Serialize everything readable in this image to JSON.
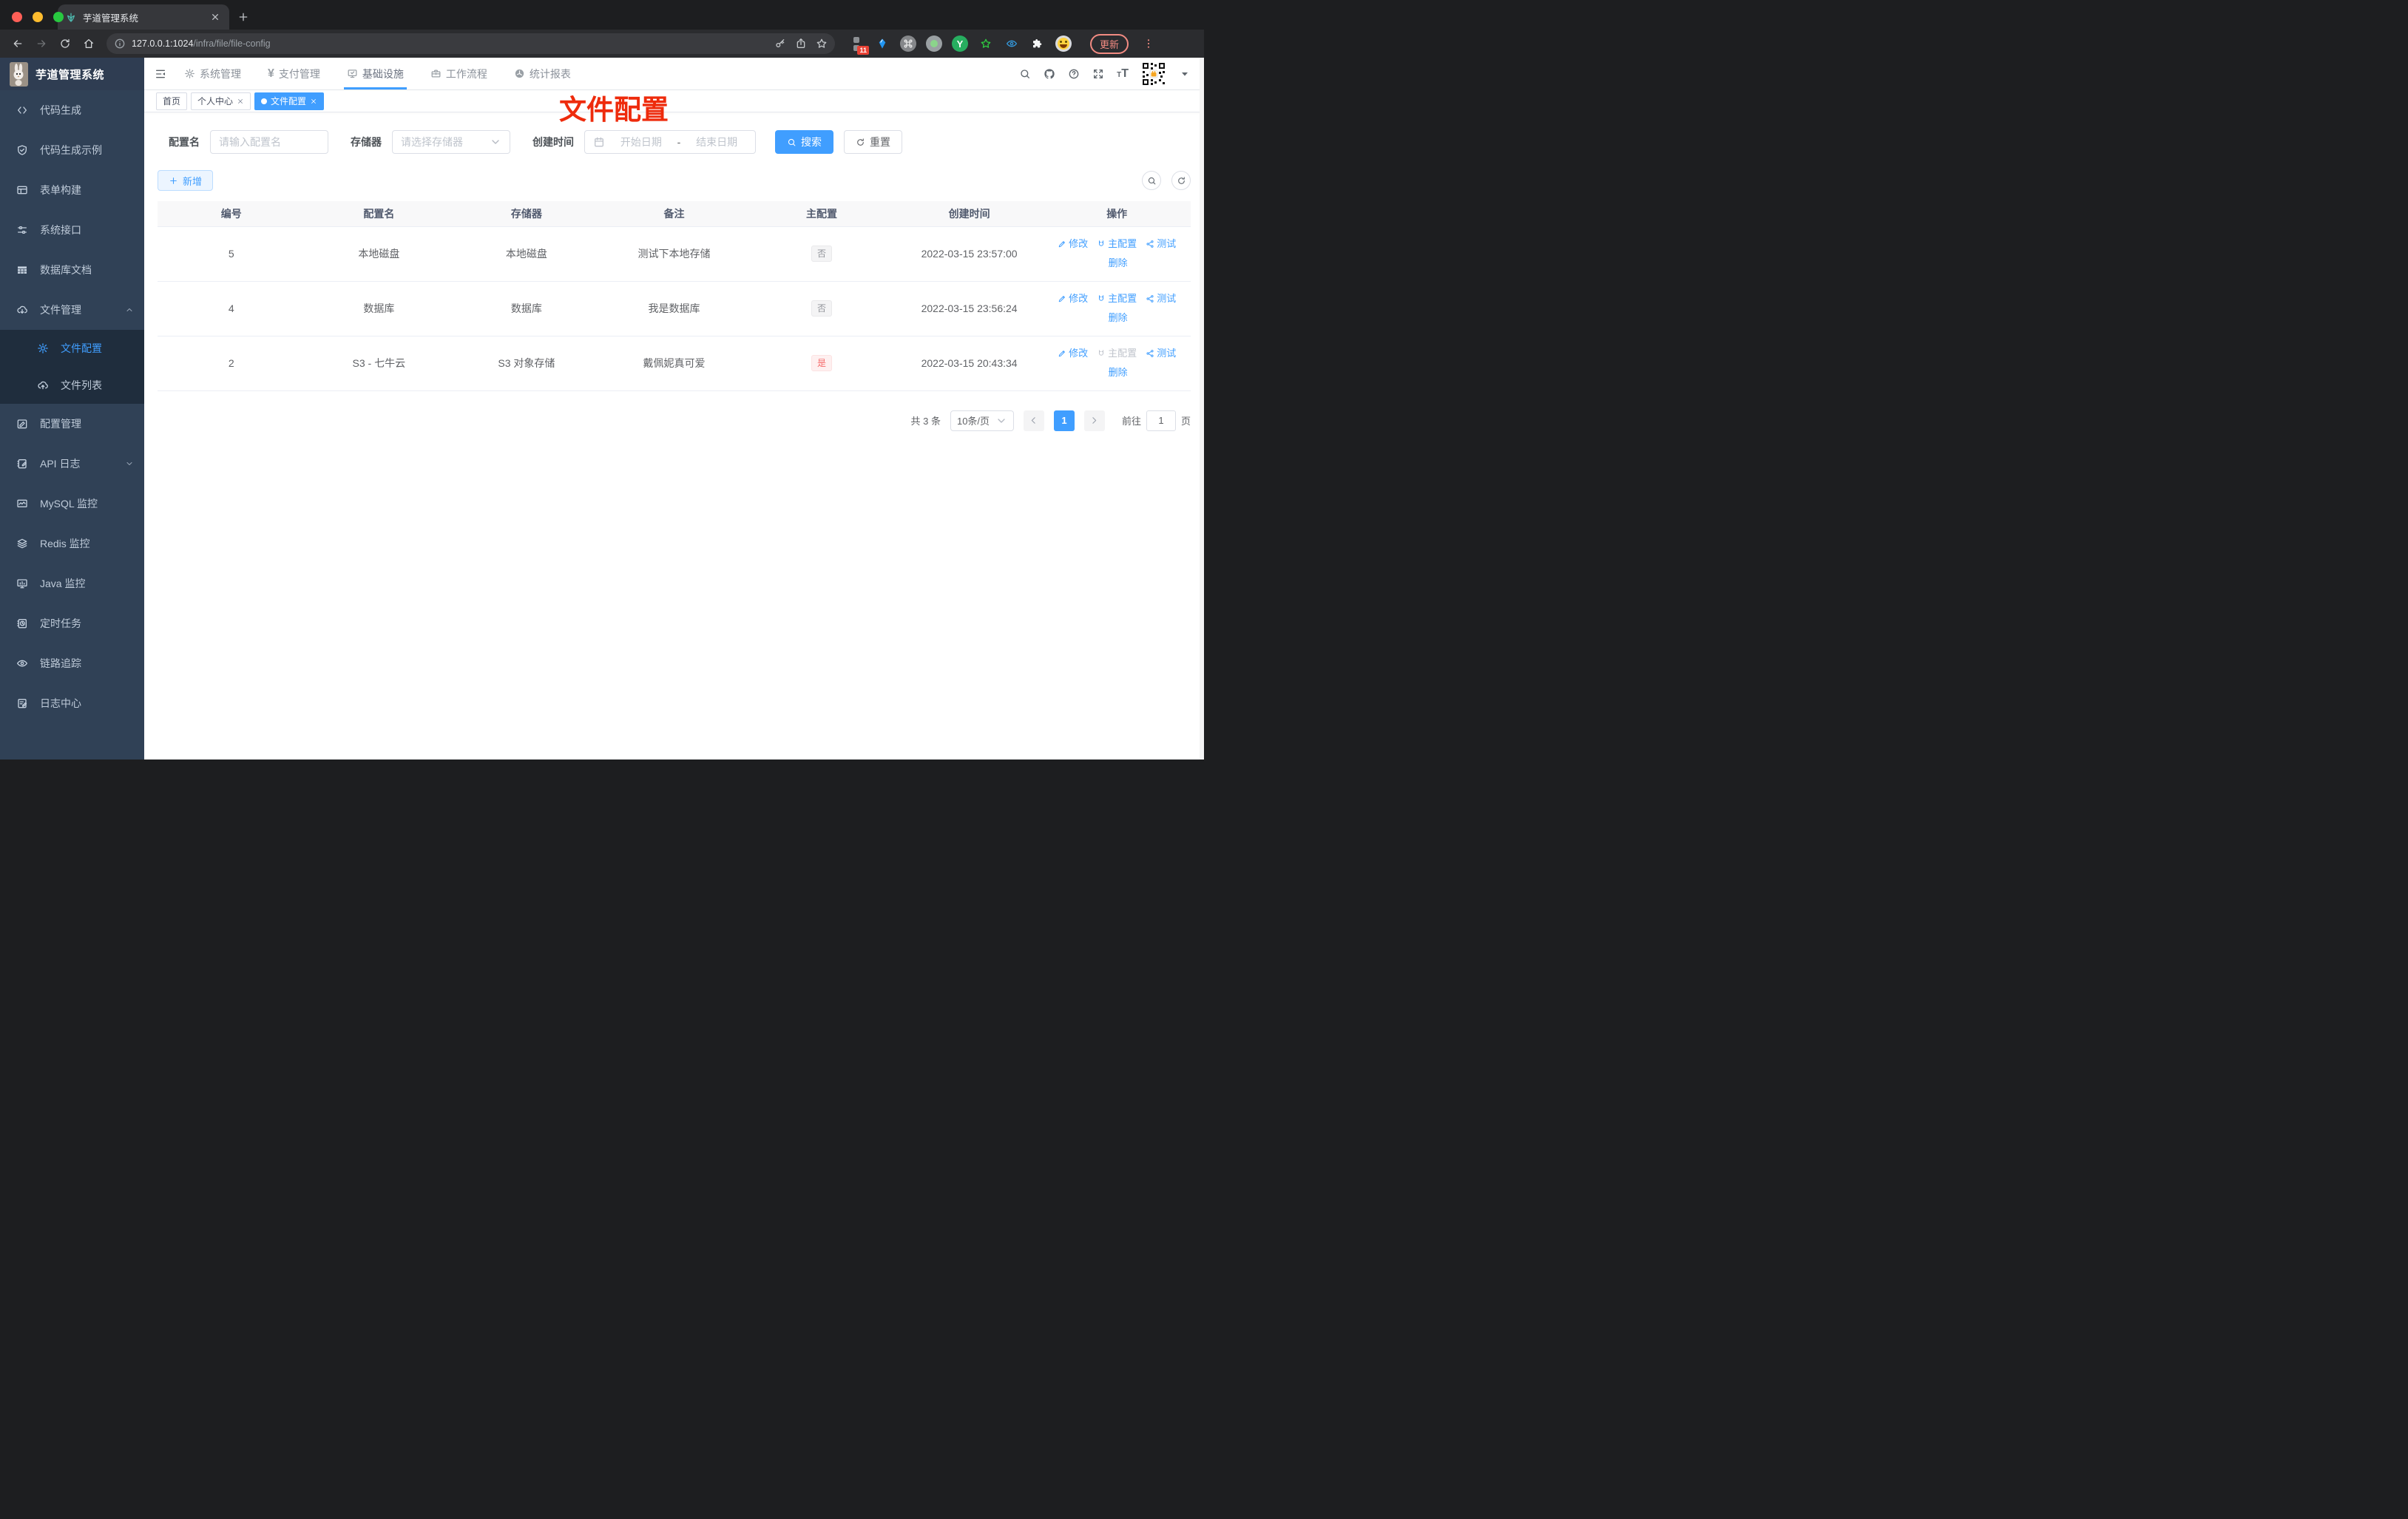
{
  "browser": {
    "tab_title": "芋道管理系统",
    "url_host": "127.0.0.1:1024",
    "url_path": "/infra/file/file-config",
    "extensions_badge": "11",
    "update_label": "更新"
  },
  "brand": {
    "title": "芋道管理系统"
  },
  "top_nav": {
    "items": [
      {
        "label": "系统管理",
        "icon": "gear",
        "active": false
      },
      {
        "label": "支付管理",
        "icon": "yen",
        "active": false
      },
      {
        "label": "基础设施",
        "icon": "monitor-check",
        "active": true
      },
      {
        "label": "工作流程",
        "icon": "briefcase",
        "active": false
      },
      {
        "label": "统计报表",
        "icon": "dashboard",
        "active": false
      }
    ]
  },
  "sidebar": {
    "items": [
      {
        "label": "代码生成",
        "icon": "code"
      },
      {
        "label": "代码生成示例",
        "icon": "shield-check"
      },
      {
        "label": "表单构建",
        "icon": "form"
      },
      {
        "label": "系统接口",
        "icon": "sliders"
      },
      {
        "label": "数据库文档",
        "icon": "grid"
      },
      {
        "label": "文件管理",
        "icon": "cloud-download",
        "expanded": true,
        "children": [
          {
            "label": "文件配置",
            "icon": "gear",
            "active": true
          },
          {
            "label": "文件列表",
            "icon": "cloud-upload"
          }
        ]
      },
      {
        "label": "配置管理",
        "icon": "edit-square"
      },
      {
        "label": "API 日志",
        "icon": "doc-edit",
        "expandable": true
      },
      {
        "label": "MySQL 监控",
        "icon": "chart-monitor"
      },
      {
        "label": "Redis 监控",
        "icon": "layers"
      },
      {
        "label": "Java 监控",
        "icon": "display"
      },
      {
        "label": "定时任务",
        "icon": "schedule"
      },
      {
        "label": "链路追踪",
        "icon": "eye"
      },
      {
        "label": "日志中心",
        "icon": "log-edit"
      }
    ]
  },
  "tags": [
    {
      "label": "首页",
      "closable": false,
      "active": false
    },
    {
      "label": "个人中心",
      "closable": true,
      "active": false
    },
    {
      "label": "文件配置",
      "closable": true,
      "active": true
    }
  ],
  "annotation": {
    "text": "文件配置",
    "color": "#ee2b0c"
  },
  "filter": {
    "name_label": "配置名",
    "name_placeholder": "请输入配置名",
    "storage_label": "存储器",
    "storage_placeholder": "请选择存储器",
    "date_label": "创建时间",
    "date_start_placeholder": "开始日期",
    "date_separator": "-",
    "date_end_placeholder": "结束日期",
    "search_label": "搜索",
    "reset_label": "重置"
  },
  "toolbar": {
    "add_label": "新增"
  },
  "table": {
    "headers": [
      "编号",
      "配置名",
      "存储器",
      "备注",
      "主配置",
      "创建时间",
      "操作"
    ],
    "rows": [
      {
        "id": "5",
        "name": "本地磁盘",
        "storage": "本地磁盘",
        "remark": "测试下本地存储",
        "primary": "否",
        "primary_type": "info",
        "created": "2022-03-15 23:57:00",
        "actions": [
          {
            "label": "修改",
            "icon": "pencil",
            "disabled": false
          },
          {
            "label": "主配置",
            "icon": "magnet",
            "disabled": false
          },
          {
            "label": "测试",
            "icon": "share",
            "disabled": false
          },
          {
            "label": "删除",
            "icon": "trash",
            "disabled": false
          }
        ]
      },
      {
        "id": "4",
        "name": "数据库",
        "storage": "数据库",
        "remark": "我是数据库",
        "primary": "否",
        "primary_type": "info",
        "created": "2022-03-15 23:56:24",
        "actions": [
          {
            "label": "修改",
            "icon": "pencil",
            "disabled": false
          },
          {
            "label": "主配置",
            "icon": "magnet",
            "disabled": false
          },
          {
            "label": "测试",
            "icon": "share",
            "disabled": false
          },
          {
            "label": "删除",
            "icon": "trash",
            "disabled": false
          }
        ]
      },
      {
        "id": "2",
        "name": "S3 - 七牛云",
        "storage": "S3 对象存储",
        "remark": "戴佩妮真可爱",
        "primary": "是",
        "primary_type": "danger",
        "created": "2022-03-15 20:43:34",
        "actions": [
          {
            "label": "修改",
            "icon": "pencil",
            "disabled": false
          },
          {
            "label": "主配置",
            "icon": "magnet",
            "disabled": true
          },
          {
            "label": "测试",
            "icon": "share",
            "disabled": false
          },
          {
            "label": "删除",
            "icon": "trash",
            "disabled": false
          }
        ]
      }
    ]
  },
  "pagination": {
    "total": "共 3 条",
    "page_size": "10条/页",
    "current_page": "1",
    "goto_label": "前往",
    "goto_value": "1",
    "page_unit": "页"
  },
  "colors": {
    "accent": "#409eff",
    "danger": "#f56c6c",
    "annotation_red": "#ee2b0c",
    "sidebar_bg": "#304156",
    "submenu_bg": "#1f2d3d"
  }
}
